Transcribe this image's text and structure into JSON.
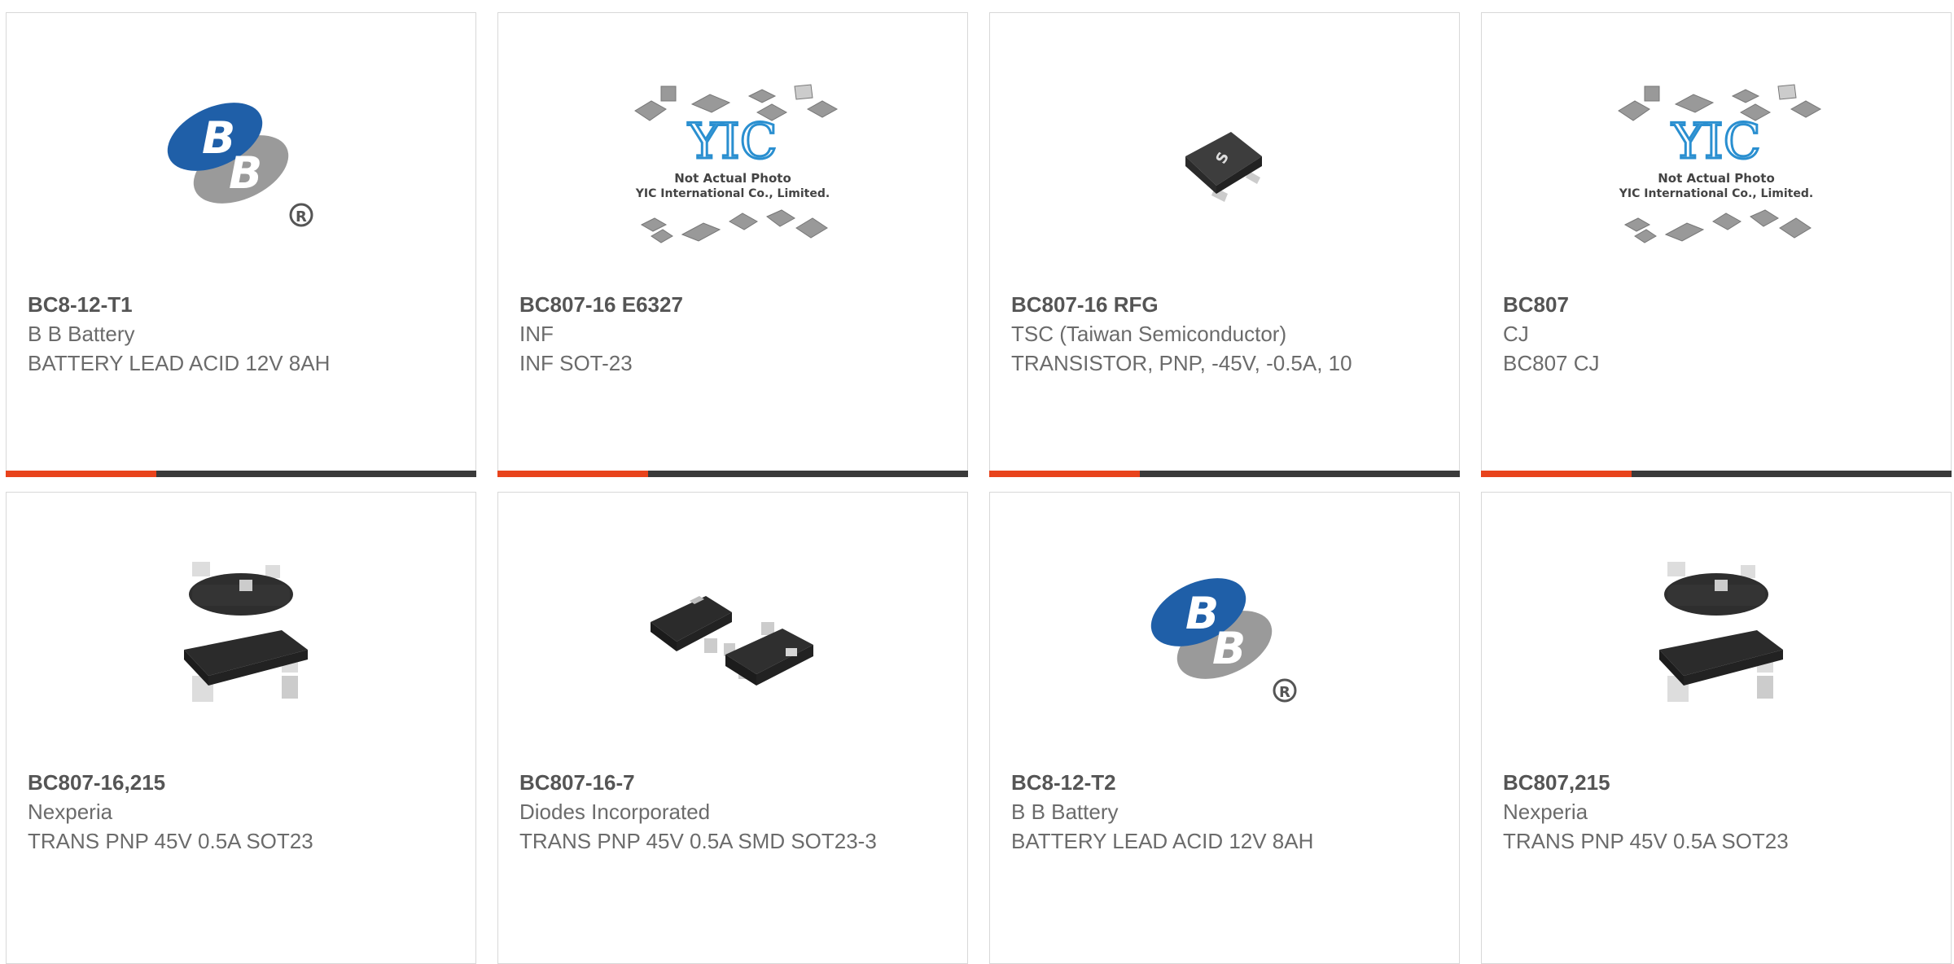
{
  "colors": {
    "accent": "#e8431c",
    "bar": "#3a3a3a",
    "bb_blue": "#1f5fa8",
    "bb_gray": "#9a9a9a",
    "yic_blue": "#2a8fd0"
  },
  "products": [
    {
      "part_number": "BC8-12-T1",
      "manufacturer": "B B Battery",
      "description": "BATTERY LEAD ACID 12V 8AH",
      "image": "bb-battery-logo",
      "accent_fraction": 0.32
    },
    {
      "part_number": "BC807-16 E6327",
      "manufacturer": "INF",
      "description": "INF SOT-23",
      "image": "yic-placeholder",
      "placeholder_line1": "Not Actual Photo",
      "placeholder_line2": "YIC International Co., Limited.",
      "accent_fraction": 0.32
    },
    {
      "part_number": "BC807-16 RFG",
      "manufacturer": "TSC (Taiwan Semiconductor)",
      "description": "TRANSISTOR, PNP, -45V, -0.5A, 10",
      "image": "sot23-single",
      "accent_fraction": 0.32
    },
    {
      "part_number": "BC807",
      "manufacturer": "CJ",
      "description": "BC807 CJ",
      "image": "yic-placeholder",
      "placeholder_line1": "Not Actual Photo",
      "placeholder_line2": "YIC International Co., Limited.",
      "accent_fraction": 0.32
    },
    {
      "part_number": "BC807-16,215",
      "manufacturer": "Nexperia",
      "description": "TRANS PNP 45V 0.5A SOT23",
      "image": "sot23-pair"
    },
    {
      "part_number": "BC807-16-7",
      "manufacturer": "Diodes Incorporated",
      "description": "TRANS PNP 45V 0.5A SMD SOT23-3",
      "image": "sot23-pair-flat"
    },
    {
      "part_number": "BC8-12-T2",
      "manufacturer": "B B Battery",
      "description": "BATTERY LEAD ACID 12V 8AH",
      "image": "bb-battery-logo"
    },
    {
      "part_number": "BC807,215",
      "manufacturer": "Nexperia",
      "description": "TRANS PNP 45V 0.5A SOT23",
      "image": "sot23-pair"
    }
  ]
}
